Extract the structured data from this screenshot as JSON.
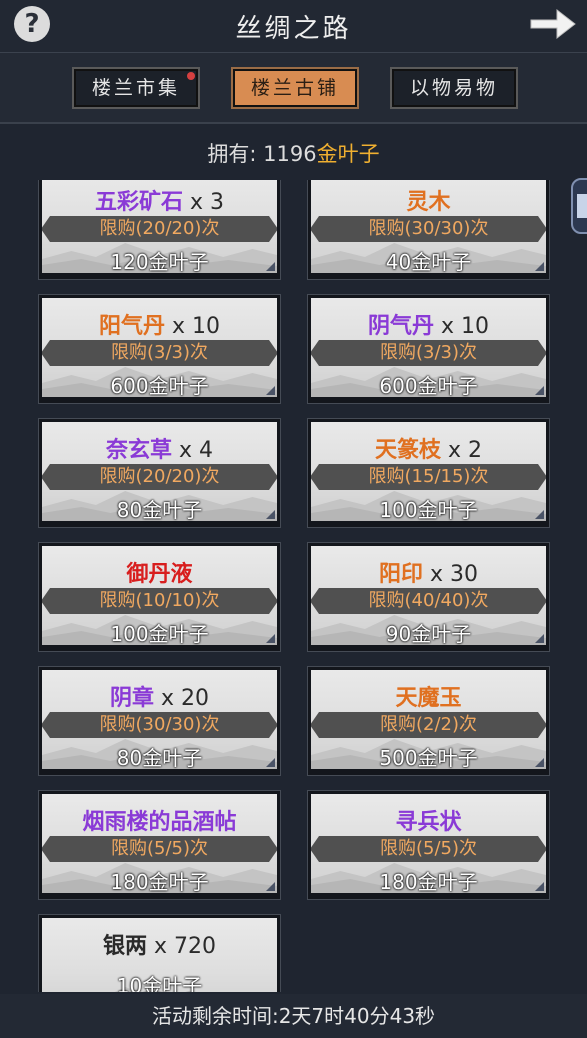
{
  "header": {
    "help_icon": "?",
    "title": "丝绸之路",
    "next_icon": "arrow-right-icon"
  },
  "tabs": [
    {
      "label": "楼兰市集",
      "active": false,
      "badge": true
    },
    {
      "label": "楼兰古铺",
      "active": true,
      "badge": false
    },
    {
      "label": "以物易物",
      "active": false,
      "badge": false
    }
  ],
  "owned": {
    "label": "拥有: ",
    "amount": "1196",
    "currency": "金叶子"
  },
  "items": [
    {
      "name": "五彩矿石",
      "qty": " x 3",
      "color": "purple",
      "limit": "限购(20/20)次",
      "price": "120金叶子"
    },
    {
      "name": "灵木",
      "qty": "",
      "color": "orange",
      "limit": "限购(30/30)次",
      "price": "40金叶子"
    },
    {
      "name": "阳气丹",
      "qty": " x 10",
      "color": "orange",
      "limit": "限购(3/3)次",
      "price": "600金叶子"
    },
    {
      "name": "阴气丹",
      "qty": " x 10",
      "color": "purple",
      "limit": "限购(3/3)次",
      "price": "600金叶子"
    },
    {
      "name": "奈玄草",
      "qty": " x 4",
      "color": "purple",
      "limit": "限购(20/20)次",
      "price": "80金叶子"
    },
    {
      "name": "天篆枝",
      "qty": " x 2",
      "color": "orange",
      "limit": "限购(15/15)次",
      "price": "100金叶子"
    },
    {
      "name": "御丹液",
      "qty": "",
      "color": "red",
      "limit": "限购(10/10)次",
      "price": "100金叶子"
    },
    {
      "name": "阳印",
      "qty": " x 30",
      "color": "orange",
      "limit": "限购(40/40)次",
      "price": "90金叶子"
    },
    {
      "name": "阴章",
      "qty": " x 20",
      "color": "purple",
      "limit": "限购(30/30)次",
      "price": "80金叶子"
    },
    {
      "name": "天魔玉",
      "qty": "",
      "color": "orange",
      "limit": "限购(2/2)次",
      "price": "500金叶子"
    },
    {
      "name": "烟雨楼的品酒帖",
      "qty": "",
      "color": "purple",
      "limit": "限购(5/5)次",
      "price": "180金叶子"
    },
    {
      "name": "寻兵状",
      "qty": "",
      "color": "purple",
      "limit": "限购(5/5)次",
      "price": "180金叶子"
    },
    {
      "name": "银两",
      "qty": " x 720",
      "color": "black",
      "limit": "",
      "price": "10金叶子"
    }
  ],
  "footer": {
    "countdown": "活动剩余时间:2天7时40分43秒"
  },
  "colors": {
    "active_tab": "#d88c52",
    "gold": "#f0b030",
    "limit_text": "#f0a860",
    "background": "#1f2530"
  }
}
